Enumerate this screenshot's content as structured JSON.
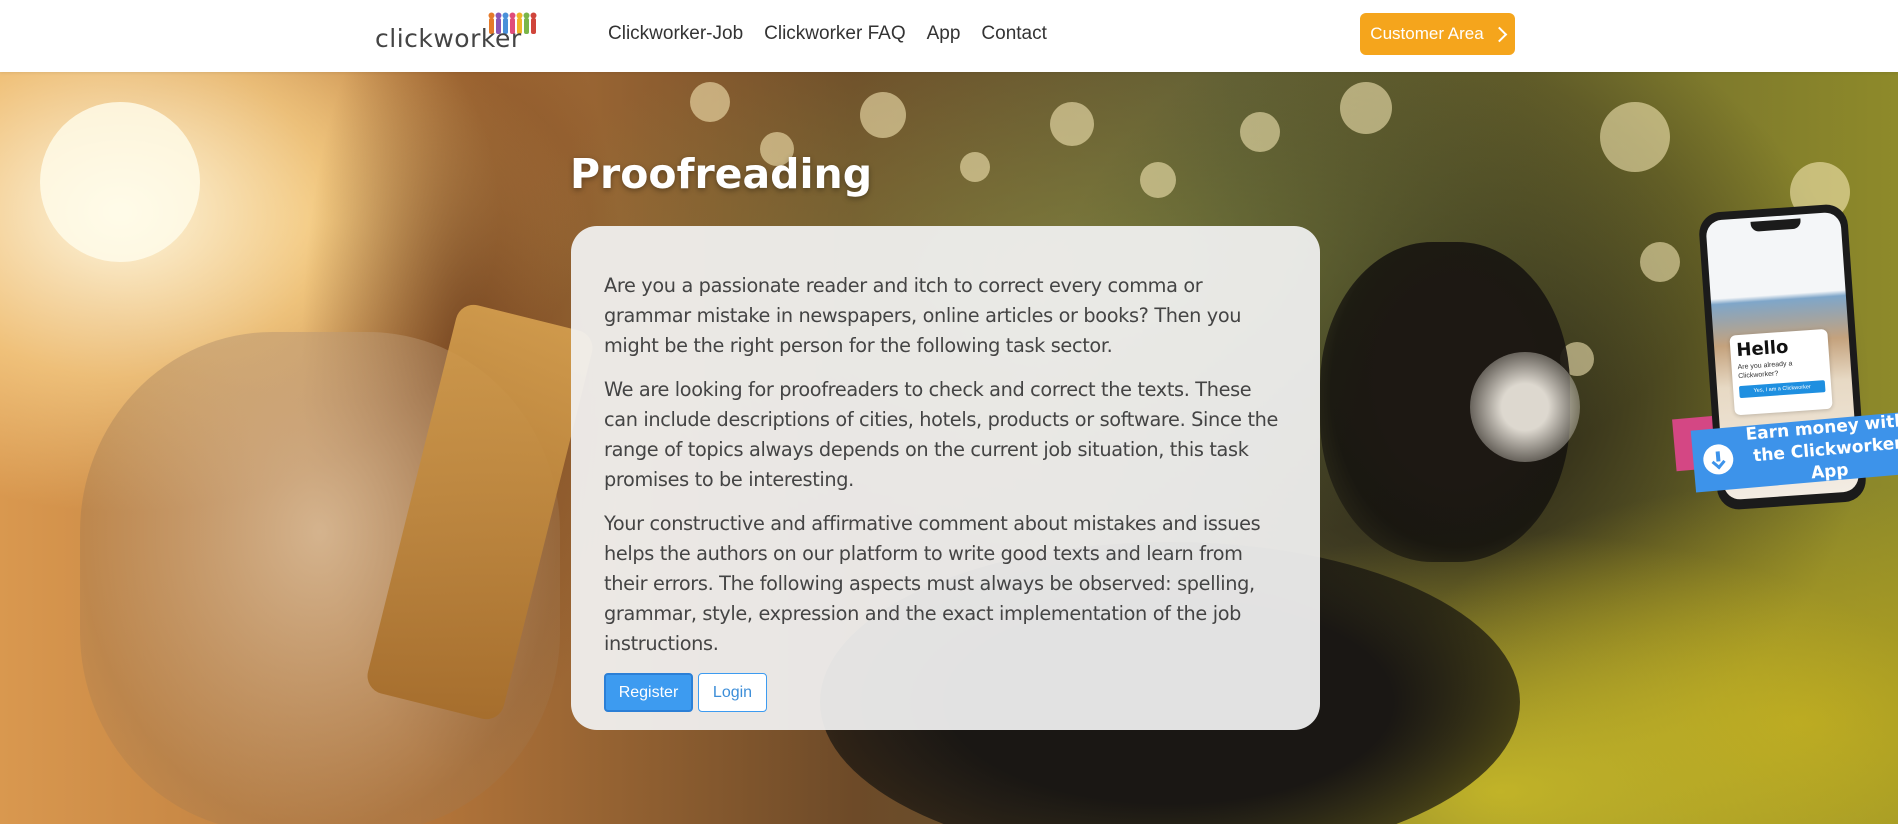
{
  "header": {
    "logo_text": "clickworker",
    "nav": [
      "Clickworker-Job",
      "Clickworker FAQ",
      "App",
      "Contact"
    ],
    "customer_area_label": "Customer Area",
    "colors": {
      "accent": "#f5a51c"
    }
  },
  "hero": {
    "title": "Proofreading",
    "paragraphs": [
      "Are you a passionate reader and itch to correct every comma or grammar mistake in newspapers, online articles or books? Then you might be the right person for the following task sector.",
      "We are looking for proofreaders to check and correct the texts. These can include descriptions of cities, hotels, products or software. Since the range of topics always depends on the current job situation, this task promises to be interesting.",
      "Your constructive and affirmative comment about mistakes and issues helps the authors on our platform to write good texts and learn from their errors. The following aspects must always be observed: spelling, grammar, style, expression and the exact implementation of the job instructions."
    ],
    "register_label": "Register",
    "login_label": "Login",
    "colors": {
      "primary": "#3d9bf0"
    }
  },
  "app_promo": {
    "phone_hello": "Hello",
    "phone_question": "Are you already a Clickworker?",
    "phone_button": "Yes, I am a Clickworker",
    "ribbon_line1": "Earn money with",
    "ribbon_line2": "the Clickworker App",
    "icon": "download-icon"
  }
}
